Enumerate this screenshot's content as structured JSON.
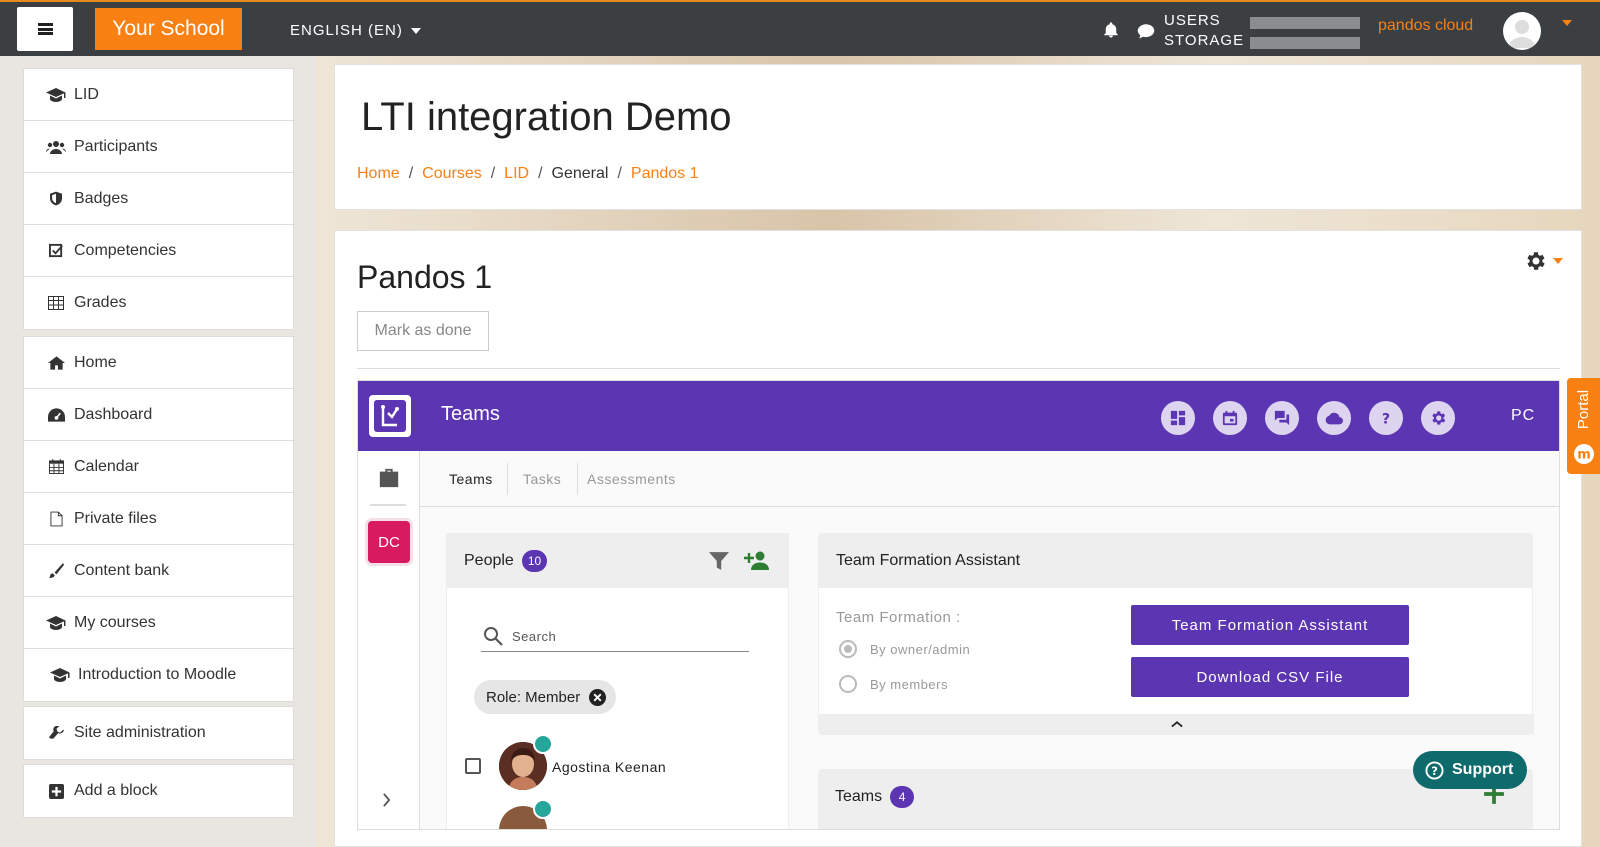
{
  "topbar": {
    "brand": "Your School",
    "language": "ENGLISH (EN)",
    "usage_users": "USERS",
    "usage_storage": "STORAGE",
    "cloud_name": "pandos cloud"
  },
  "sidebar": {
    "group1": [
      {
        "label": "LID",
        "icon": "graduation-cap-icon"
      },
      {
        "label": "Participants",
        "icon": "users-icon"
      },
      {
        "label": "Badges",
        "icon": "shield-icon"
      },
      {
        "label": "Competencies",
        "icon": "check-square-icon"
      },
      {
        "label": "Grades",
        "icon": "table-icon"
      }
    ],
    "group2": [
      {
        "label": "Home",
        "icon": "home-icon"
      },
      {
        "label": "Dashboard",
        "icon": "dashboard-icon"
      },
      {
        "label": "Calendar",
        "icon": "calendar-icon"
      },
      {
        "label": "Private files",
        "icon": "file-icon"
      },
      {
        "label": "Content bank",
        "icon": "paint-brush-icon"
      },
      {
        "label": "My courses",
        "icon": "graduation-cap-icon"
      },
      {
        "label": "Introduction to Moodle",
        "icon": "graduation-cap-icon"
      }
    ],
    "site_admin": "Site administration",
    "add_block": "Add a block"
  },
  "header": {
    "title": "LTI integration Demo",
    "breadcrumb": [
      "Home",
      "Courses",
      "LID",
      "General",
      "Pandos 1"
    ]
  },
  "activity": {
    "title": "Pandos 1",
    "mark_done": "Mark as done"
  },
  "teams_app": {
    "title": "Teams",
    "user_initials": "PC",
    "workspace_initials": "DC",
    "tabs": [
      "Teams",
      "Tasks",
      "Assessments"
    ],
    "people": {
      "title": "People",
      "count": "10",
      "search_placeholder": "Search",
      "filter_chip": "Role: Member",
      "members": [
        "Agostina Keenan"
      ]
    },
    "formation": {
      "title": "Team Formation Assistant",
      "label": "Team Formation :",
      "option1": "By owner/admin",
      "option2": "By members",
      "button1": "Team Formation Assistant",
      "button2": "Download CSV File"
    },
    "teams": {
      "title": "Teams",
      "count": "4"
    }
  },
  "support": "Support",
  "portal": "Portal",
  "colors": {
    "accent": "#f98012",
    "teams_purple": "#5c35b3",
    "support_teal": "#0f6b6b",
    "topbar": "#3b3f42"
  }
}
